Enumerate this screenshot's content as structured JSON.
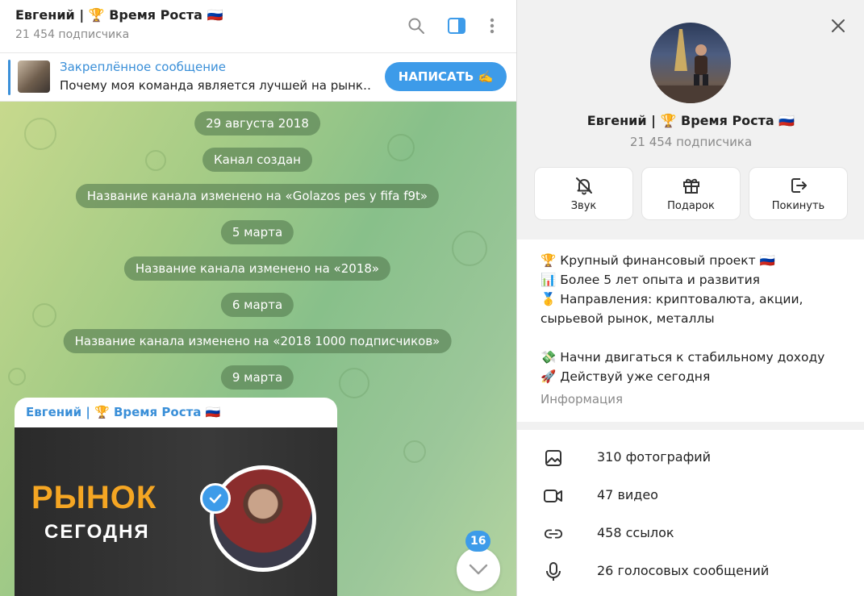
{
  "chat": {
    "title": "Евгений | 🏆 Время Роста 🇷🇺",
    "subscribers": "21 454 подписчика",
    "icons": [
      "search-icon",
      "sidebar-toggle-icon",
      "more-vertical-icon"
    ],
    "pinned": {
      "title": "Закреплённое сообщение",
      "text": "Почему моя команда является лучшей на рынк…",
      "button": "НАПИСАТЬ ✍️"
    },
    "service_messages": [
      "29 августа 2018",
      "Канал создан",
      "Название канала изменено на «Golazos pes y fifa f9t»",
      "5 марта",
      "Название канала изменено на «2018»",
      "6 марта",
      "Название канала изменено на «2018 1000 подписчиков»",
      "9 марта"
    ],
    "post": {
      "author": "Евгений | 🏆 Время Роста 🇷🇺",
      "banner_line1": "РЫНОК",
      "banner_line2": "СЕГОДНЯ"
    },
    "unread_count": "16"
  },
  "info": {
    "name": "Евгений | 🏆 Время Роста 🇷🇺",
    "subscribers": "21 454 подписчика",
    "actions": [
      {
        "label": "Звук",
        "icon": "bell-off-icon"
      },
      {
        "label": "Подарок",
        "icon": "gift-icon"
      },
      {
        "label": "Покинуть",
        "icon": "leave-icon"
      }
    ],
    "description": [
      "🏆 Крупный финансовый проект 🇷🇺",
      "📊 Более 5 лет опыта и развития",
      "🥇 Направления: криптовалюта, акции,",
      "сырьевой рынок, металлы",
      "💸 Начни двигаться к стабильному доходу",
      "🚀 Действуй уже сегодня"
    ],
    "description_label": "Информация",
    "media": [
      {
        "label": "310 фотографий",
        "icon": "photo-icon"
      },
      {
        "label": "47 видео",
        "icon": "video-icon"
      },
      {
        "label": "458 ссылок",
        "icon": "link-icon"
      },
      {
        "label": "26 голосовых сообщений",
        "icon": "microphone-icon"
      }
    ]
  },
  "colors": {
    "accent": "#3d9be9",
    "link": "#3a8fd8",
    "banner_orange": "#f5a623"
  }
}
